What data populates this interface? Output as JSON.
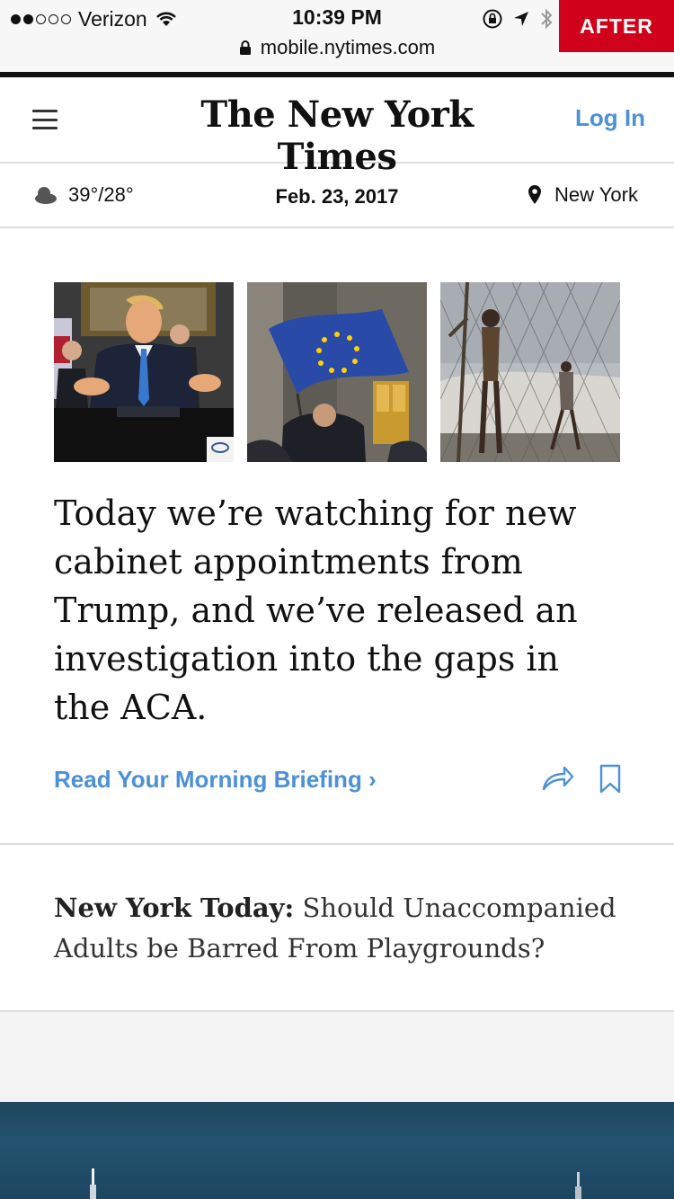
{
  "status_bar": {
    "carrier": "Verizon",
    "time": "10:39 PM",
    "badge": "AFTER",
    "url": "mobile.nytimes.com"
  },
  "masthead": {
    "logo": "The New York Times",
    "login": "Log In"
  },
  "info_bar": {
    "temperature": "39°/28°",
    "date": "Feb. 23, 2017",
    "location": "New York"
  },
  "briefing": {
    "headline": "Today we’re watching for new cabinet appointments from Trump, and we’ve released an investigation into the gaps in the ACA.",
    "link_label": "Read Your Morning Briefing",
    "link_chevron": "›"
  },
  "nyt_today": {
    "kicker": "New York Today:",
    "title": "Should Unaccompanied Adults be Barred From Playgrounds?"
  },
  "colors": {
    "accent_blue": "#4b90d8",
    "badge_red": "#d0021b"
  },
  "icons": [
    "wifi-icon",
    "lock-icon",
    "location-arrow-icon",
    "bluetooth-icon",
    "menu-icon",
    "cloud-icon",
    "location-pin-icon",
    "share-icon",
    "bookmark-icon"
  ]
}
